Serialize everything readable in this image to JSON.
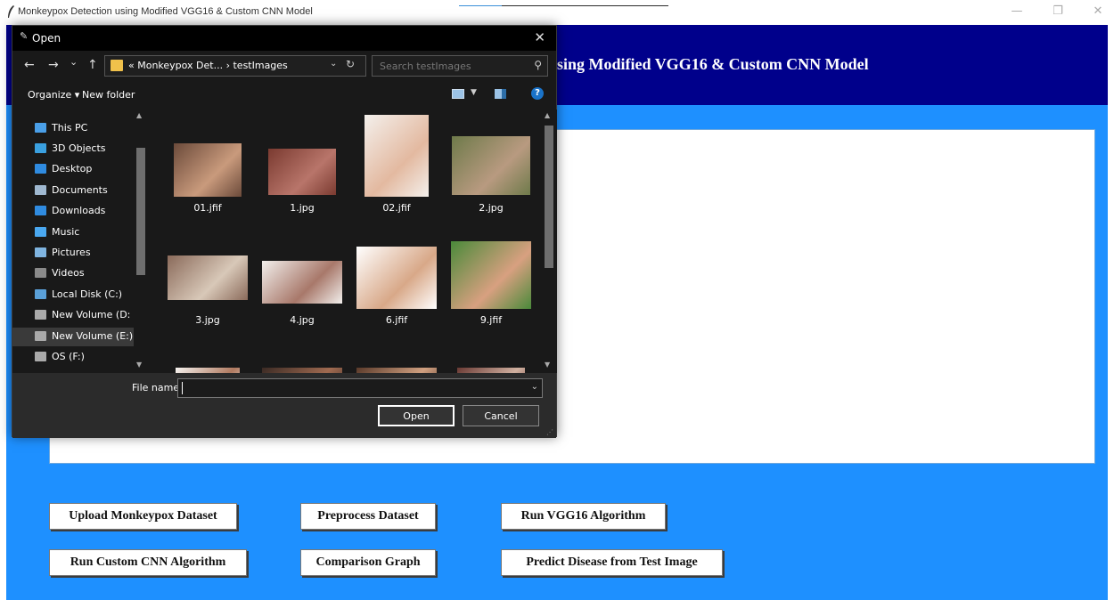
{
  "app": {
    "window_title": "Monkeypox Detection using Modified VGG16 & Custom CNN Model",
    "header_title_visible": "sing Modified VGG16 & Custom CNN Model",
    "controls": {
      "minimize": "—",
      "restore": "❐",
      "close": "✕"
    },
    "colors": {
      "body": "#1e90ff",
      "header": "#00008b"
    },
    "buttons": {
      "upload": "Upload Monkeypox Dataset",
      "preprocess": "Preprocess Dataset",
      "run_vgg16": "Run VGG16 Algorithm",
      "run_cnn": "Run Custom CNN Algorithm",
      "comparison": "Comparison Graph",
      "predict": "Predict Disease from Test Image"
    }
  },
  "dialog": {
    "title": "Open",
    "close": "✕",
    "nav": {
      "back": "←",
      "forward": "→",
      "recent": "⌄",
      "up": "↑"
    },
    "breadcrumb": "« Monkeypox Det... › testImages",
    "search_placeholder": "Search testImages",
    "organize": "Organize ▾",
    "new_folder": "New folder",
    "help": "?",
    "sidebar": [
      {
        "label": "This PC",
        "icon": "computer-icon",
        "color": "#4a9fe8"
      },
      {
        "label": "3D Objects",
        "icon": "cube-icon",
        "color": "#3aa0e0"
      },
      {
        "label": "Desktop",
        "icon": "desktop-icon",
        "color": "#2f8be0"
      },
      {
        "label": "Documents",
        "icon": "documents-icon",
        "color": "#9fb8d0"
      },
      {
        "label": "Downloads",
        "icon": "download-icon",
        "color": "#2f8be0"
      },
      {
        "label": "Music",
        "icon": "music-icon",
        "color": "#4aa8f0"
      },
      {
        "label": "Pictures",
        "icon": "pictures-icon",
        "color": "#7fb4e0"
      },
      {
        "label": "Videos",
        "icon": "videos-icon",
        "color": "#8a8a8a"
      },
      {
        "label": "Local Disk (C:)",
        "icon": "drive-icon",
        "color": "#5aa0d8"
      },
      {
        "label": "New Volume (D:",
        "icon": "drive-icon",
        "color": "#aaaaaa"
      },
      {
        "label": "New Volume (E:)",
        "icon": "drive-icon",
        "color": "#aaaaaa"
      },
      {
        "label": "OS (F:)",
        "icon": "drive-icon",
        "color": "#aaaaaa"
      }
    ],
    "files": [
      {
        "name": "01.jfif",
        "colors": [
          "#6b4a3a",
          "#c99a7c"
        ]
      },
      {
        "name": "1.jpg",
        "colors": [
          "#7a3a30",
          "#b8756a"
        ]
      },
      {
        "name": "02.jfif",
        "colors": [
          "#f4f0ec",
          "#e3b9a0"
        ]
      },
      {
        "name": "2.jpg",
        "colors": [
          "#6e7a4a",
          "#b89a80"
        ]
      },
      {
        "name": "3.jpg",
        "colors": [
          "#8a6a5a",
          "#d8c8b8"
        ]
      },
      {
        "name": "4.jpg",
        "colors": [
          "#f2efec",
          "#a8786a"
        ]
      },
      {
        "name": "6.jfif",
        "colors": [
          "#ffffff",
          "#d8a888"
        ]
      },
      {
        "name": "9.jfif",
        "colors": [
          "#4a8a3a",
          "#d8a080"
        ]
      },
      {
        "name": "",
        "colors": [
          "#f6f3f0",
          "#b07a60"
        ]
      },
      {
        "name": "",
        "colors": [
          "#3a2a24",
          "#a06a50"
        ]
      },
      {
        "name": "",
        "colors": [
          "#5a3a2a",
          "#d0a080"
        ]
      },
      {
        "name": "",
        "colors": [
          "#6a3a34",
          "#d0b0a0"
        ]
      }
    ],
    "file_name_label": "File name:",
    "file_name_value": "",
    "open_button": "Open",
    "cancel_button": "Cancel"
  }
}
